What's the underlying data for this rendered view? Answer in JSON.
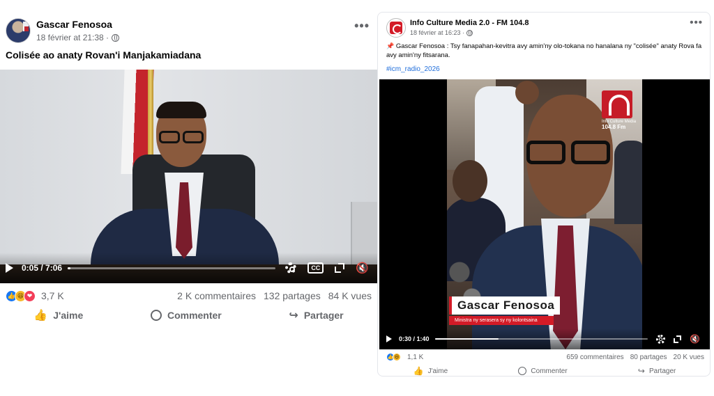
{
  "left_post": {
    "author": "Gascar Fenosoa",
    "timestamp": "18 février at 21:38 ·",
    "caption": "Colisée ao anaty Rovan'i Manjakamiadana",
    "video": {
      "current_time": "0:05",
      "duration": "7:06",
      "progress": 0.012,
      "cc_label": "CC"
    },
    "stats": {
      "reaction_count": "3,7 K",
      "comments": "2 K commentaires",
      "shares": "132 partages",
      "views": "84 K vues"
    },
    "actions": {
      "like": "J'aime",
      "comment": "Commenter",
      "share": "Partager"
    },
    "more_glyph": "•••"
  },
  "right_post": {
    "page_name": "Info Culture Media 2.0 - FM 104.8",
    "timestamp": "18 février at 16:23 ·",
    "pin_glyph": "📌",
    "caption": "Gascar Fenosoa : Tsy fanapahan-kevitra avy  amin'ny olo-tokana no  hanalana ny \"colisée\"  anaty  Rova fa avy amin'ny fitsarana.",
    "hashtag": "#icm_radio_2026",
    "video": {
      "lower_third_name": "Gascar Fenosoa",
      "lower_third_sub": "Ministra ny serasera sy ny kolontsaina",
      "watermark_line1": "Info Culture Media",
      "watermark_line2": "104.8 Fm",
      "current_time": "0:30",
      "duration": "1:40",
      "progress": 0.3
    },
    "stats": {
      "reaction_count": "1,1 K",
      "comments": "659 commentaires",
      "shares": "80 partages",
      "views": "20 K vues"
    },
    "actions": {
      "like": "J'aime",
      "comment": "Commenter",
      "share": "Partager"
    },
    "more_glyph": "•••"
  },
  "icons": {
    "like": "👍",
    "share": "↪",
    "mute": "🔇",
    "reaction_like": "👍",
    "reaction_haha": "😆",
    "reaction_love": "❤"
  },
  "colors": {
    "facebook_blue": "#1877f2",
    "secondary_text": "#65676b",
    "hashtag_blue": "#216fdb",
    "brand_red": "#d31b27"
  }
}
